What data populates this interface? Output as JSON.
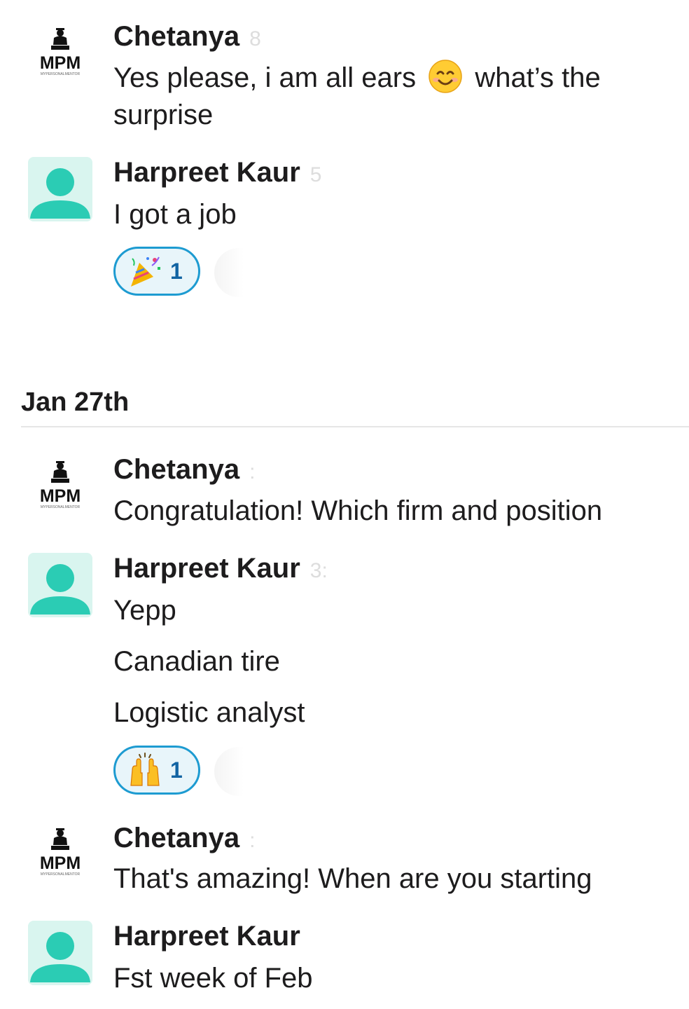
{
  "messages": [
    {
      "author": "Chetanya",
      "avatar": "mpm-logo",
      "text_before_emoji": "Yes please, i am all ears",
      "emoji": "smiling-face-emoji",
      "text_after_emoji": "what’s the",
      "text_line2": "surprise"
    },
    {
      "author": "Harpreet Kaur",
      "avatar": "default-person",
      "text": "I got a job",
      "reaction": {
        "emoji": "party-popper-emoji",
        "count": "1"
      }
    }
  ],
  "date_divider": {
    "label": "Jan 27th"
  },
  "messages_after": [
    {
      "author": "Chetanya",
      "avatar": "mpm-logo",
      "text": "Congratulation! Which firm and position"
    },
    {
      "author": "Harpreet Kaur",
      "avatar": "default-person",
      "lines": [
        "Yepp",
        "Canadian tire",
        "Logistic analyst"
      ],
      "reaction": {
        "emoji": "raising-hands-emoji",
        "count": "1"
      }
    },
    {
      "author": "Chetanya",
      "avatar": "mpm-logo",
      "text": "That's amazing! When are you starting"
    },
    {
      "author": "Harpreet Kaur",
      "avatar": "default-person",
      "text": "Fst week of Feb"
    }
  ],
  "logo": {
    "letters": "MPM",
    "tagline": "MYPERSONALMENTOR"
  },
  "colors": {
    "person_avatar_bg": "#d9f5ef",
    "person_avatar_fg": "#2bccb4",
    "reaction_border": "#1d9bd1",
    "reaction_bg": "#e8f5fa",
    "reaction_count": "#1264a3",
    "text": "#1d1c1d"
  }
}
